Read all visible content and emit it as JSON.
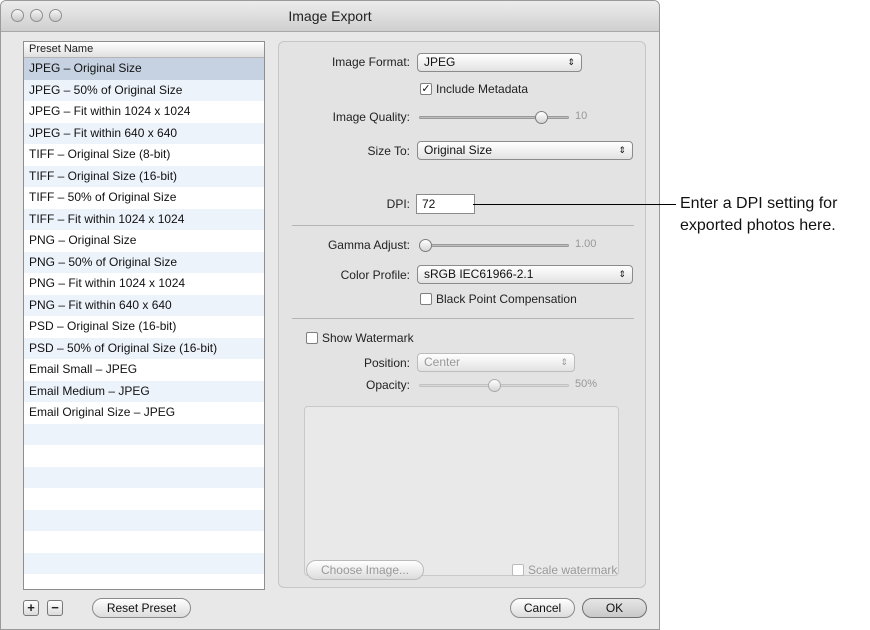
{
  "window": {
    "title": "Image Export"
  },
  "preset_list": {
    "header": "Preset Name",
    "selected_index": 0,
    "items": [
      "JPEG – Original Size",
      "JPEG – 50% of Original Size",
      "JPEG – Fit within 1024 x 1024",
      "JPEG – Fit within 640 x 640",
      "TIFF – Original Size (8-bit)",
      "TIFF – Original Size (16-bit)",
      "TIFF – 50% of Original Size",
      "TIFF – Fit within 1024 x 1024",
      "PNG – Original Size",
      "PNG – 50% of Original Size",
      "PNG – Fit within 1024 x 1024",
      "PNG – Fit within 640 x 640",
      "PSD – Original Size (16-bit)",
      "PSD – 50% of Original Size (16-bit)",
      "Email Small – JPEG",
      "Email Medium – JPEG",
      "Email Original Size – JPEG",
      "",
      "",
      "",
      "",
      "",
      "",
      "",
      ""
    ]
  },
  "settings": {
    "image_format": {
      "label": "Image Format:",
      "value": "JPEG"
    },
    "include_metadata": {
      "label": "Include Metadata",
      "checked": true
    },
    "image_quality": {
      "label": "Image Quality:",
      "value": "10",
      "level": 0.85
    },
    "size_to": {
      "label": "Size To:",
      "value": "Original Size"
    },
    "dpi": {
      "label": "DPI:",
      "value": "72"
    },
    "gamma_adjust": {
      "label": "Gamma Adjust:",
      "value": "1.00",
      "level": 0.0
    },
    "color_profile": {
      "label": "Color Profile:",
      "value": "sRGB IEC61966-2.1"
    },
    "black_point_compensation": {
      "label": "Black Point Compensation",
      "checked": false
    },
    "show_watermark": {
      "label": "Show Watermark",
      "checked": false
    },
    "position": {
      "label": "Position:",
      "value": "Center"
    },
    "opacity": {
      "label": "Opacity:",
      "value": "50%",
      "level": 0.5
    },
    "choose_image": "Choose Image...",
    "scale_watermark": {
      "label": "Scale watermark",
      "checked": false
    }
  },
  "footer": {
    "add": "+",
    "remove": "−",
    "reset_preset": "Reset Preset",
    "cancel": "Cancel",
    "ok": "OK"
  },
  "callout": {
    "line1": "Enter a DPI setting for",
    "line2": "exported photos here."
  },
  "icons": {
    "popup_arrows": "updown-arrows-icon",
    "checkmark": "checkmark-icon"
  }
}
